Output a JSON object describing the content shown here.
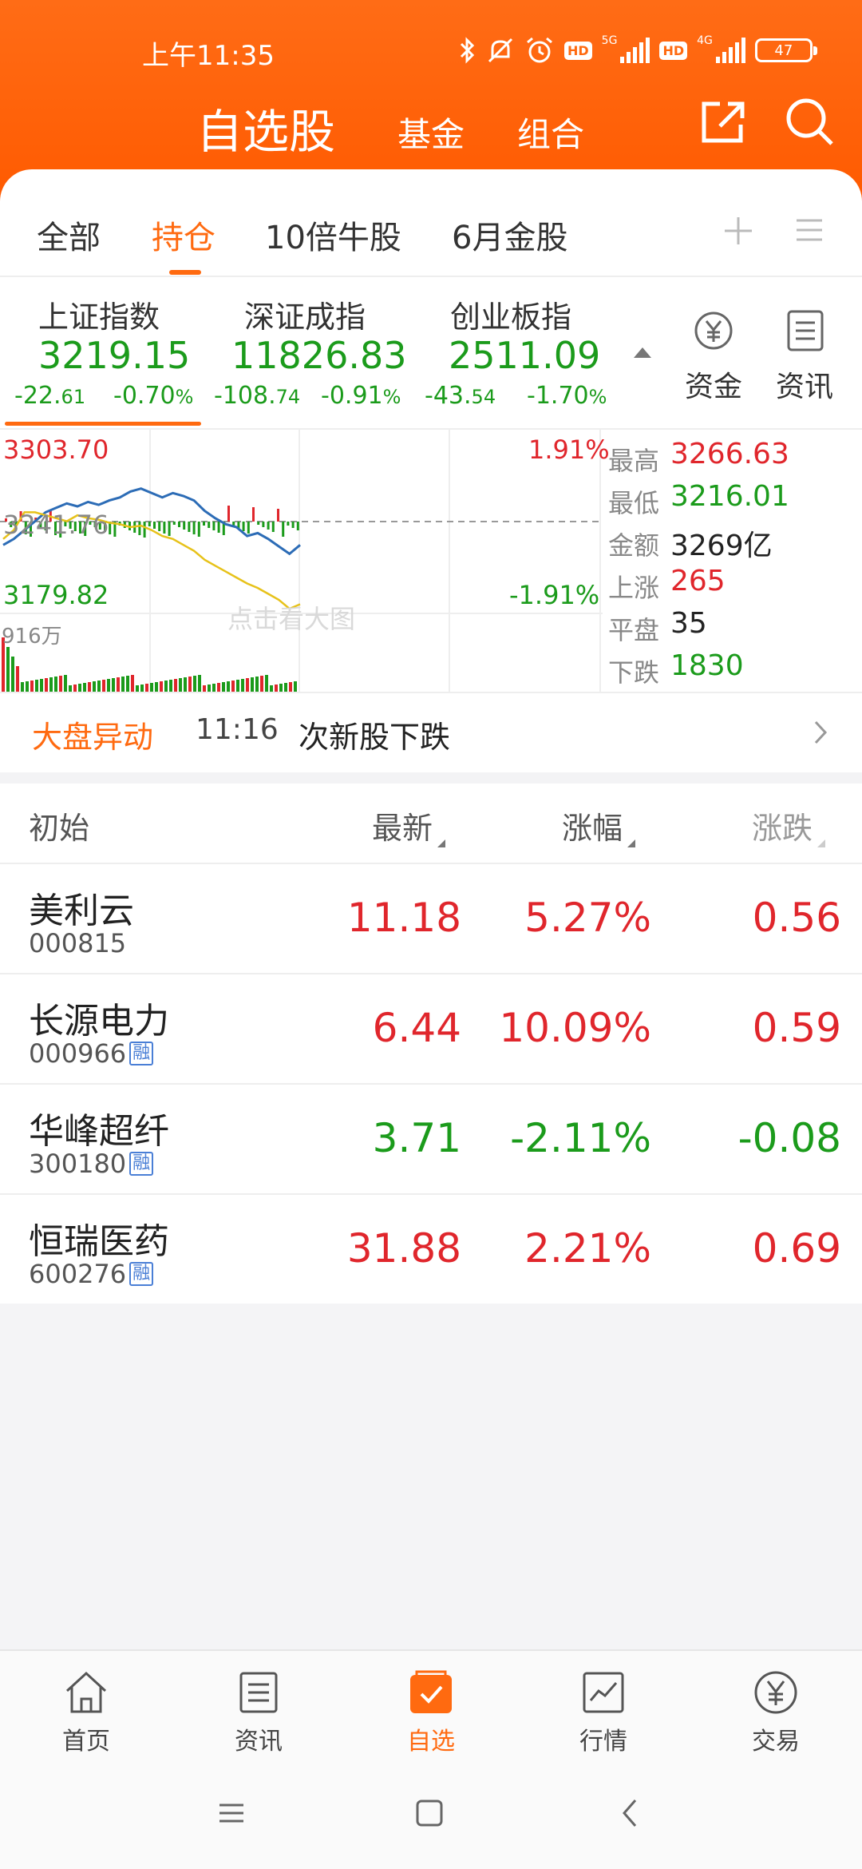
{
  "status_bar": {
    "time": "上午11:35",
    "net1": "5G",
    "net2": "4G",
    "hd": "HD",
    "battery": "47"
  },
  "header": {
    "title": "自选股",
    "tabs": [
      "基金",
      "组合"
    ]
  },
  "sub_tabs": [
    "全部",
    "持仓",
    "10倍牛股",
    "6月金股"
  ],
  "indices": [
    {
      "name": "上证指数",
      "value": "3219.15",
      "change": "-22.",
      "change_small": "61",
      "pct": "-0.70",
      "pct_unit": "%"
    },
    {
      "name": "深证成指",
      "value": "11826.83",
      "change": "-108.",
      "change_small": "74",
      "pct": "-0.91",
      "pct_unit": "%"
    },
    {
      "name": "创业板指",
      "value": "2511.09",
      "change": "-43.",
      "change_small": "54",
      "pct": "-1.70",
      "pct_unit": "%"
    }
  ],
  "side_buttons": {
    "funds": "资金",
    "news": "资讯"
  },
  "chart": {
    "high_label": "3303.70",
    "high_pct": "1.91%",
    "mid_label": "3241.76",
    "low_label": "3179.82",
    "low_pct": "-1.91%",
    "volume_label": "916万",
    "watermark": "点击看大图"
  },
  "chart_data": {
    "type": "line",
    "ylim": [
      3179.82,
      3303.7
    ],
    "series": [
      {
        "values": [
          3226,
          3230,
          3236,
          3242,
          3248,
          3251,
          3254,
          3252,
          3255,
          3253,
          3256,
          3258,
          3262,
          3264,
          3261,
          3258,
          3261,
          3259,
          3256,
          3249,
          3244,
          3240,
          3238,
          3232,
          3234,
          3230,
          3225,
          3220,
          3226
        ]
      },
      {
        "values": [
          3230,
          3236,
          3248,
          3248,
          3246,
          3244,
          3242,
          3246,
          3244,
          3243,
          3241,
          3240,
          3238,
          3239,
          3236,
          3232,
          3230,
          3226,
          3222,
          3216,
          3212,
          3208,
          3204,
          3200,
          3197,
          3193,
          3189,
          3183,
          3186
        ]
      }
    ]
  },
  "stats": [
    {
      "label": "最高",
      "value": "3266.63",
      "color": "#e0262c"
    },
    {
      "label": "最低",
      "value": "3216.01",
      "color": "#1b9b1b"
    },
    {
      "label": "金额",
      "value": "3269亿",
      "color": "#222222"
    },
    {
      "label": "上涨",
      "value": "265",
      "color": "#e0262c"
    },
    {
      "label": "平盘",
      "value": "35",
      "color": "#222222"
    },
    {
      "label": "下跌",
      "value": "1830",
      "color": "#1b9b1b"
    }
  ],
  "market_alert": {
    "title": "大盘异动",
    "time": "11:16",
    "text": "次新股下跌"
  },
  "table": {
    "headers": [
      "初始",
      "最新",
      "涨幅",
      "涨跌"
    ],
    "rows": [
      {
        "name": "美利云",
        "code": "000815",
        "rong": "",
        "price": "11.18",
        "pct": "5.27%",
        "chg": "0.56",
        "dir": "up"
      },
      {
        "name": "长源电力",
        "code": "000966",
        "rong": "融",
        "price": "6.44",
        "pct": "10.09%",
        "chg": "0.59",
        "dir": "up"
      },
      {
        "name": "华峰超纤",
        "code": "300180",
        "rong": "融",
        "price": "3.71",
        "pct": "-2.11%",
        "chg": "-0.08",
        "dir": "down"
      },
      {
        "name": "恒瑞医药",
        "code": "600276",
        "rong": "融",
        "price": "31.88",
        "pct": "2.21%",
        "chg": "0.69",
        "dir": "up"
      }
    ]
  },
  "bottom_nav": [
    "首页",
    "资讯",
    "自选",
    "行情",
    "交易"
  ],
  "colors": {
    "accent": "#ff6a10",
    "up": "#e0262c",
    "down": "#1b9b1b"
  }
}
